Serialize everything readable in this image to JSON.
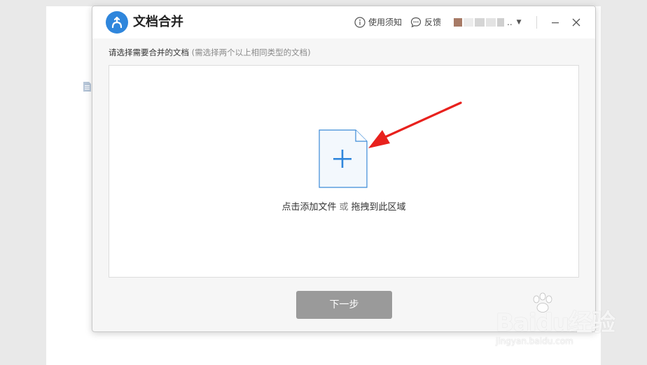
{
  "app": {
    "title": "文档合并",
    "accent_color": "#2f86dc"
  },
  "titlebar": {
    "guide_label": "使用须知",
    "guide_icon": "info-circle-icon",
    "feedback_label": "反馈",
    "feedback_icon": "chat-bubble-icon",
    "user_name_suffix": "..",
    "user_menu_icon": "caret-down-icon",
    "minimize_icon": "minimize-icon",
    "close_icon": "close-icon"
  },
  "main": {
    "hint": "请选择需要合并的文档",
    "hint_sub": "(需选择两个以上相同类型的文档)",
    "add_file_icon": "file-plus-icon",
    "drop_text_add": "点击添加文件",
    "drop_text_or": "或",
    "drop_text_drag": "拖拽到此区域"
  },
  "footer": {
    "next_label": "下一步",
    "next_color": "#9a9a9a"
  },
  "watermark": {
    "main": "Baidu经验",
    "sub": "jingyan.baidu.com"
  }
}
